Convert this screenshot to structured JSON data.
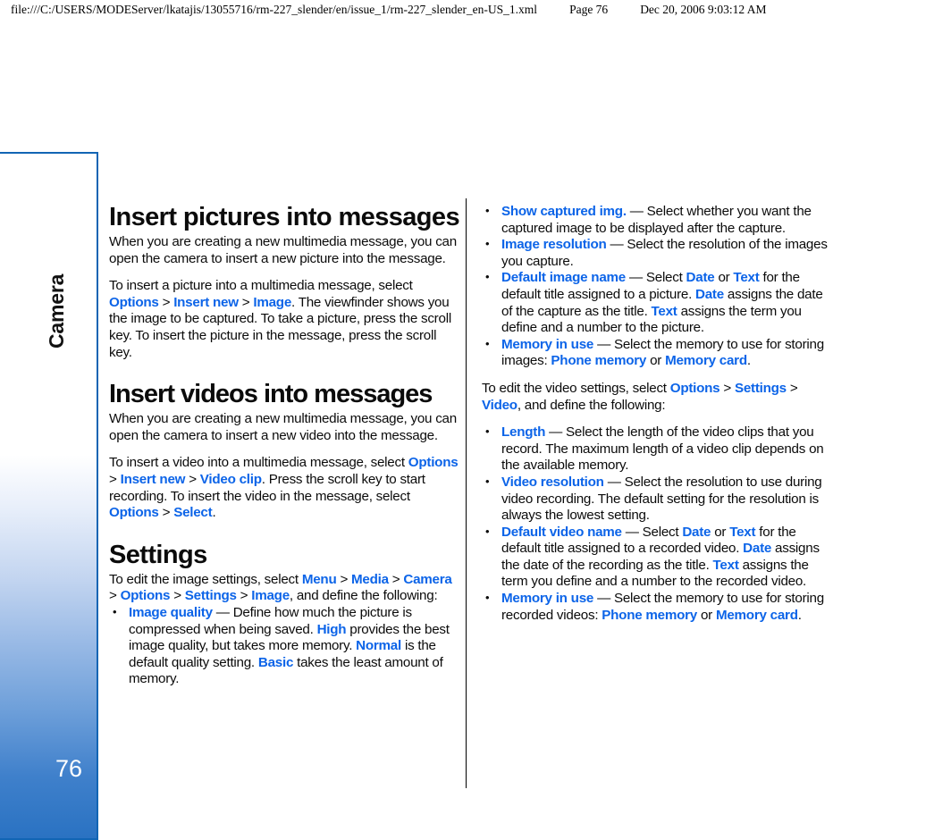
{
  "print_header": {
    "url": "file:///C:/USERS/MODEServer/lkatajis/13055716/rm-227_slender/en/issue_1/rm-227_slender_en-US_1.xml",
    "page": "Page 76",
    "date": "Dec 20, 2006 9:03:12 AM"
  },
  "sidebar": {
    "chapter_label": "Camera",
    "page_number": "76",
    "accent_color": "#2a72c2",
    "border_color": "#1265b4"
  },
  "colors": {
    "link_blue": "#0c64e8",
    "text_black": "#0b0b0b",
    "background": "#ffffff"
  },
  "left_column": {
    "heading_1": "Insert pictures into messages",
    "para_1": "When you are creating a new multimedia message, you can open the camera to insert a new picture into the message.",
    "para_2_pre": "To insert a picture into a multimedia message, select ",
    "para_2_link_1": "Options",
    "para_2_link_2": "Insert new",
    "para_2_link_3": "Image",
    "para_2_post": ". The viewfinder shows you the image to be captured. To take a picture, press the scroll key. To insert the picture in the message, press the scroll key.",
    "heading_2": "Insert videos into messages",
    "para_3": "When you are creating a new multimedia message, you can open the camera to insert a new video into the message.",
    "para_4_pre": "To insert a video into a multimedia message, select ",
    "para_4_link_1": "Options",
    "para_4_link_2": "Insert new",
    "para_4_link_3": "Video clip",
    "para_4_mid": ". Press the scroll key to start recording. To insert the video in the message, select ",
    "para_4_link_4": "Options",
    "para_4_link_5": "Select",
    "para_4_post": ".",
    "heading_3": "Settings",
    "para_5_pre": "To edit the image settings, select ",
    "para_5_link_1": "Menu",
    "para_5_link_2": "Media",
    "para_5_link_3": "Camera",
    "para_5_link_4": "Options",
    "para_5_link_5": "Settings",
    "para_5_link_6": "Image",
    "para_5_post": ", and define the following:",
    "bullets": [
      {
        "term": "Image quality",
        "text_1": " — Define how much the picture is compressed when being saved. ",
        "inline_1": "High",
        "text_2": " provides the best image quality, but takes more memory. ",
        "inline_2": "Normal",
        "text_3": " is the default quality setting. ",
        "inline_3": "Basic",
        "text_4": " takes the least amount of memory."
      }
    ]
  },
  "right_column": {
    "bullets_image": [
      {
        "term": "Show captured img.",
        "text_1": " — Select whether you want the captured image to be displayed after the capture."
      },
      {
        "term": "Image resolution",
        "text_1": " — Select the resolution of the images you capture."
      },
      {
        "term": "Default image name",
        "text_1": " — Select ",
        "inline_1": "Date",
        "text_2": " or ",
        "inline_2": "Text",
        "text_3": " for the default title assigned to a picture. ",
        "inline_3": "Date",
        "text_4": " assigns the date of the capture as the title. ",
        "inline_4": "Text",
        "text_5": " assigns the term you define and a number to the picture."
      },
      {
        "term": "Memory in use",
        "text_1": " — Select the memory to use for storing images: ",
        "inline_1": "Phone memory",
        "text_2": " or ",
        "inline_2": "Memory card",
        "text_3": "."
      }
    ],
    "para_video_pre": "To edit the video settings, select ",
    "para_video_link_1": "Options",
    "para_video_link_2": "Settings",
    "para_video_link_3": "Video",
    "para_video_post": ", and define the following:",
    "bullets_video": [
      {
        "term": "Length",
        "text_1": " — Select the length of the video clips that you record. The maximum length of a video clip depends on the available memory."
      },
      {
        "term": "Video resolution",
        "text_1": " — Select the resolution to use during video recording. The default setting for the resolution is always the lowest setting."
      },
      {
        "term": "Default video name",
        "text_1": " — Select ",
        "inline_1": "Date",
        "text_2": " or ",
        "inline_2": "Text",
        "text_3": " for the default title assigned to a recorded video. ",
        "inline_3": "Date",
        "text_4": " assigns the date of the recording as the title. ",
        "inline_4": "Text",
        "text_5": " assigns the term you define and a number to the recorded video."
      },
      {
        "term": "Memory in use",
        "text_1": " — Select the memory to use for storing recorded videos: ",
        "inline_1": "Phone memory",
        "text_2": " or ",
        "inline_2": "Memory card",
        "text_3": "."
      }
    ]
  }
}
